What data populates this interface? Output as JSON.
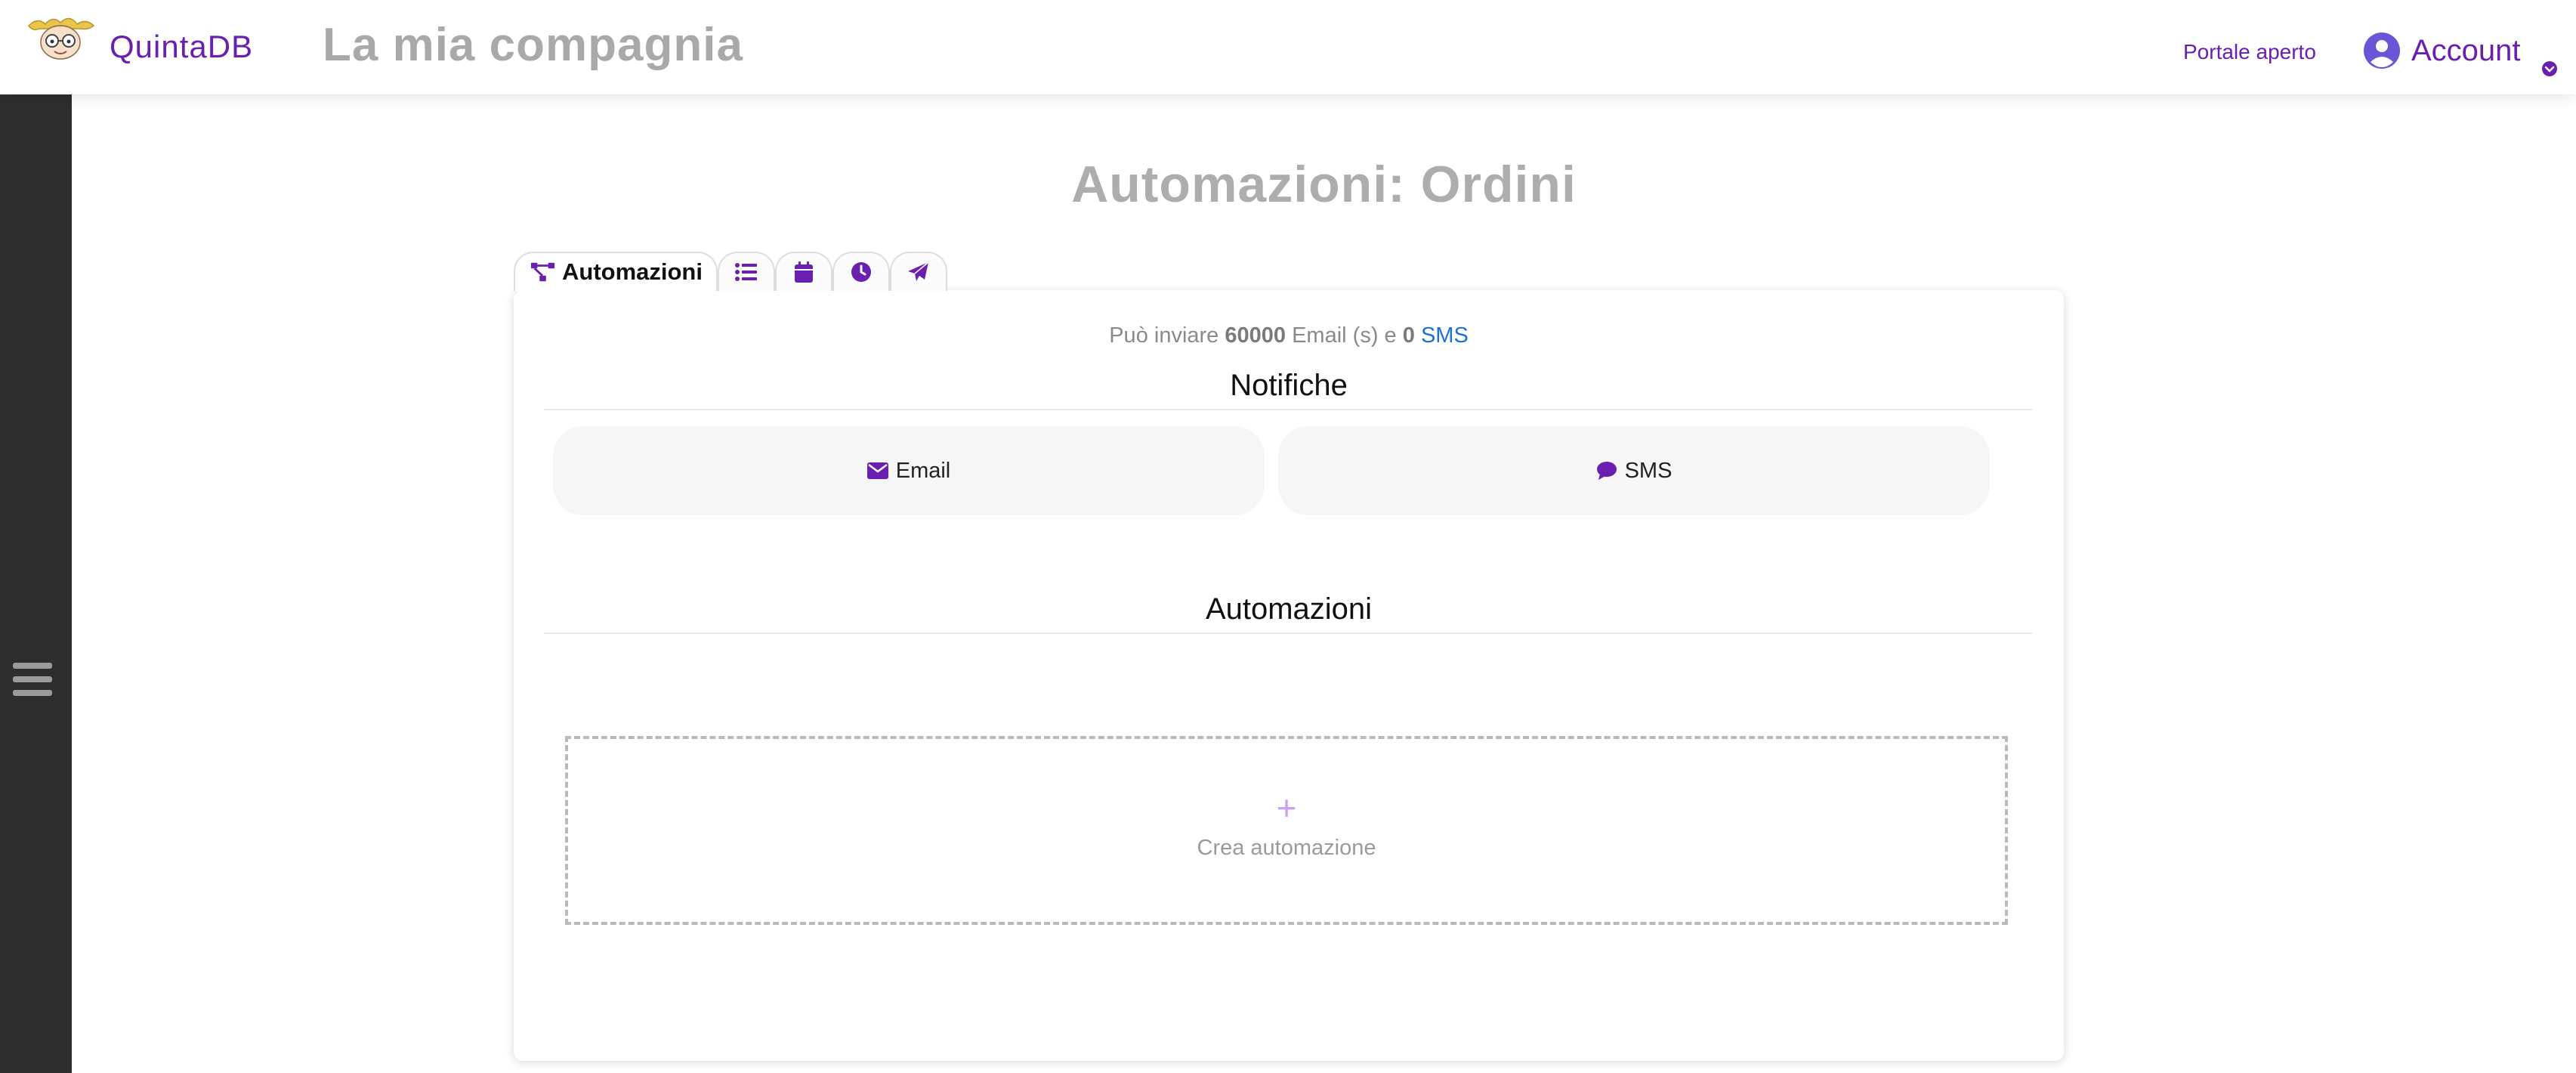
{
  "header": {
    "brand": "QuintaDB",
    "company": "La mia compagnia",
    "portal_link": "Portale aperto",
    "account_label": "Account"
  },
  "page": {
    "title": "Automazioni: Ordini"
  },
  "tabs": [
    {
      "label": "Automazioni",
      "icon": "sitemap-icon",
      "active": true
    },
    {
      "label": "",
      "icon": "list-icon"
    },
    {
      "label": "",
      "icon": "calendar-icon"
    },
    {
      "label": "",
      "icon": "clock-icon"
    },
    {
      "label": "",
      "icon": "paper-plane-icon"
    }
  ],
  "quota": {
    "prefix": "Può inviare",
    "email_count": "60000",
    "email_text": "Email (s) e",
    "sms_count": "0",
    "sms_label": "SMS"
  },
  "notifications": {
    "title": "Notifiche",
    "email_label": "Email",
    "sms_label": "SMS"
  },
  "automations": {
    "title": "Automazioni",
    "create_icon": "+",
    "create_label": "Crea automazione"
  },
  "colors": {
    "brand": "#6a1fb0",
    "sidebar": "#2e2e2e",
    "link": "#1f6fd6",
    "muted": "#a9a9a9"
  }
}
